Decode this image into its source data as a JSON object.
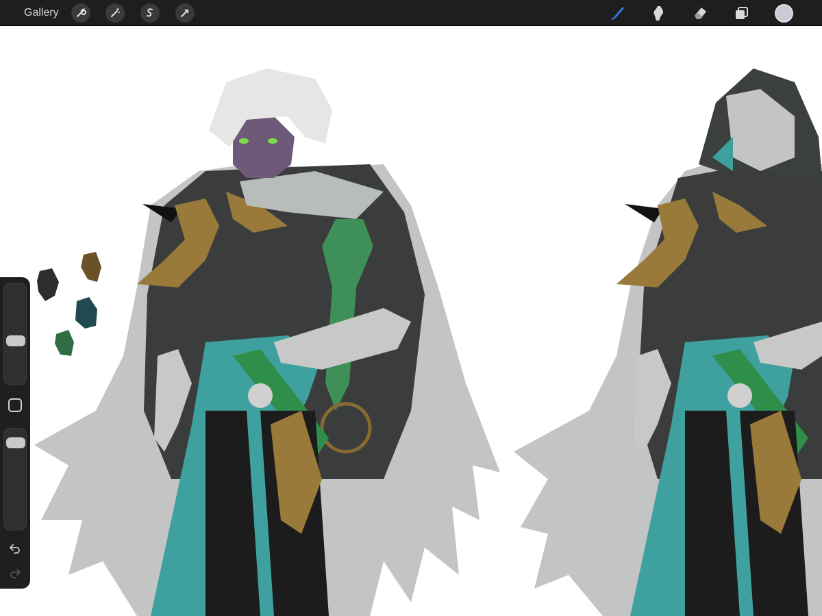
{
  "toolbar": {
    "gallery_label": "Gallery",
    "left_actions": [
      "wrench-icon",
      "magic-wand-icon",
      "selection-s-icon",
      "transform-arrow-icon"
    ],
    "right_tools": [
      "brush-icon",
      "smudge-icon",
      "eraser-icon",
      "layers-icon"
    ],
    "active_tool": "brush-icon",
    "active_tool_color": "#2f7bf0",
    "current_color": "#c8cbd6"
  },
  "sidebar": {
    "brush_size_level": 0.42,
    "opacity_level": 0.08,
    "controls": [
      "size-slider",
      "modify-button",
      "opacity-slider",
      "undo-icon",
      "redo-icon"
    ]
  },
  "canvas": {
    "background": "#ffffff",
    "palette_swatches": [
      "#6b5226",
      "#2b2e2e",
      "#1f4a4f",
      "#2f6e45"
    ],
    "figures": [
      "character-unhooded",
      "character-hooded"
    ]
  }
}
